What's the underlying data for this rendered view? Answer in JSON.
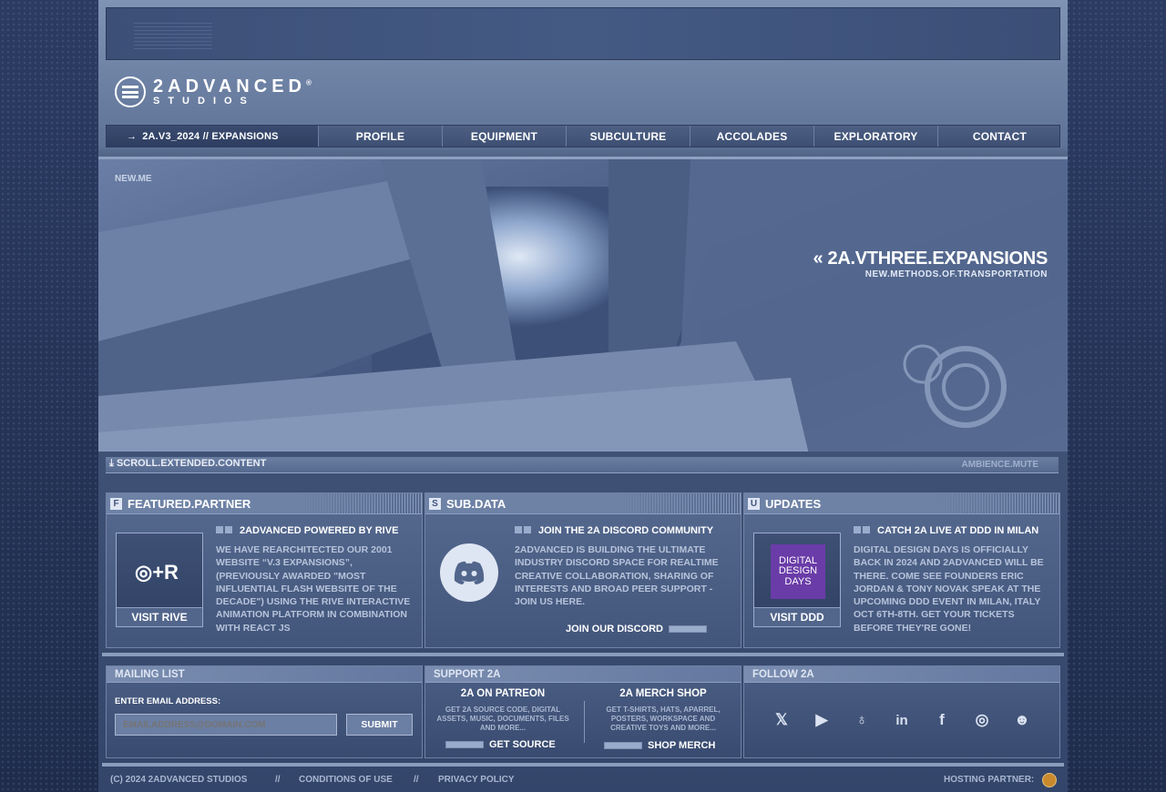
{
  "logo": {
    "line1": "2ADVANCED",
    "line2": "STUDIOS",
    "mark": "®"
  },
  "nav": {
    "current": "2A.V3_2024 // EXPANSIONS",
    "items": [
      "PROFILE",
      "EQUIPMENT",
      "SUBCULTURE",
      "ACCOLADES",
      "EXPLORATORY",
      "CONTACT"
    ]
  },
  "hero": {
    "tag": "NEW.ME",
    "title": "2A.VTHREE.EXPANSIONS",
    "subtitle": "NEW.METHODS.OF.TRANSPORTATION"
  },
  "scrollbar": {
    "left": "SCROLL.EXTENDED.CONTENT",
    "right": "AMBIENCE.MUTE"
  },
  "panels": {
    "featured": {
      "head": "FEATURED.PARTNER",
      "icon_letter": "F",
      "title": "2ADVANCED POWERED BY RIVE",
      "text": "WE HAVE REARCHITECTED OUR 2001 WEBSITE “V.3 EXPANSIONS”, (PREVIOUSLY AWARDED \"MOST INFLUENTIAL FLASH WEBSITE OF THE DECADE\") USING THE RIVE INTERACTIVE ANIMATION PLATFORM IN COMBINATION WITH REACT JS",
      "button": "VISIT RIVE"
    },
    "subdata": {
      "head": "SUB.DATA",
      "icon_letter": "S",
      "title": "JOIN THE 2A DISCORD COMMUNITY",
      "text": "2ADVANCED IS BUILDING THE ULTIMATE INDUSTRY DISCORD SPACE FOR REALTIME CREATIVE COLLABORATION, SHARING OF INTERESTS AND BROAD PEER SUPPORT - JOIN US HERE.",
      "button": "JOIN OUR DISCORD"
    },
    "updates": {
      "head": "UPDATES",
      "icon_letter": "U",
      "title": "CATCH 2A LIVE AT DDD IN MILAN",
      "text": "DIGITAL DESIGN DAYS IS OFFICIALLY BACK IN 2024 AND 2ADVANCED WILL BE THERE. COME SEE FOUNDERS ERIC JORDAN & TONY NOVAK SPEAK AT THE UPCOMING DDD EVENT IN MILAN, ITALY OCT 6TH-8TH. GET YOUR TICKETS BEFORE THEY'RE GONE!",
      "thumb_lines": [
        "DIGITAL",
        "DESIGN",
        "DAYS"
      ],
      "button": "VISIT DDD"
    }
  },
  "mailing": {
    "head": "MAILING LIST",
    "label": "ENTER EMAIL ADDRESS:",
    "placeholder": "EMAILADDRESS@DOMAIN.COM",
    "submit": "SUBMIT"
  },
  "support": {
    "head": "SUPPORT 2A",
    "patreon": {
      "title": "2A ON PATREON",
      "desc": "GET 2A SOURCE CODE, DIGITAL ASSETS, MUSIC, DOCUMENTS, FILES AND MORE...",
      "button": "GET SOURCE"
    },
    "merch": {
      "title": "2A MERCH SHOP",
      "desc": "GET T-SHIRTS, HATS, APARREL, POSTERS, WORKSPACE AND CREATIVE TOYS AND MORE...",
      "button": "SHOP MERCH"
    }
  },
  "follow": {
    "head": "FOLLOW 2A",
    "icons": [
      "x-icon",
      "youtube-icon",
      "github-icon",
      "linkedin-icon",
      "facebook-icon",
      "instagram-icon",
      "discord-icon"
    ]
  },
  "footer": {
    "copyright": "(C) 2024 2ADVANCED STUDIOS",
    "sep": "//",
    "conditions": "CONDITIONS OF USE",
    "privacy": "PRIVACY POLICY",
    "hosting": "HOSTING PARTNER:"
  },
  "colors": {
    "accent": "#dfe6f3",
    "frame": "#52668a",
    "background": "#233256"
  }
}
